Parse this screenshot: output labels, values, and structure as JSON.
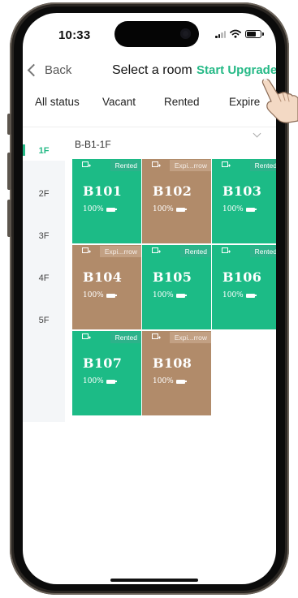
{
  "status_bar": {
    "time": "10:33"
  },
  "nav": {
    "back_label": "Back",
    "title": "Select a room",
    "action_label": "Start Upgrade"
  },
  "tabs": [
    "All status",
    "Vacant",
    "Rented",
    "Expire"
  ],
  "floors": [
    "1F",
    "2F",
    "3F",
    "4F",
    "5F"
  ],
  "active_floor": "1F",
  "building": "B-B1-1F",
  "rooms": [
    {
      "number": "B101",
      "status": "Rented",
      "battery": "100%"
    },
    {
      "number": "B102",
      "status": "Expi...rrow",
      "battery": "100%"
    },
    {
      "number": "B103",
      "status": "Rented",
      "battery": "100%"
    },
    {
      "number": "B104",
      "status": "Expi...rrow",
      "battery": "100%"
    },
    {
      "number": "B105",
      "status": "Rented",
      "battery": "100%"
    },
    {
      "number": "B106",
      "status": "Rented",
      "battery": "100%"
    },
    {
      "number": "B107",
      "status": "Rented",
      "battery": "100%"
    },
    {
      "number": "B108",
      "status": "Expi...rrow",
      "battery": "100%"
    }
  ],
  "colors": {
    "accent": "#25b986",
    "rented": "#1cbb86",
    "expired": "#b18b6a"
  }
}
